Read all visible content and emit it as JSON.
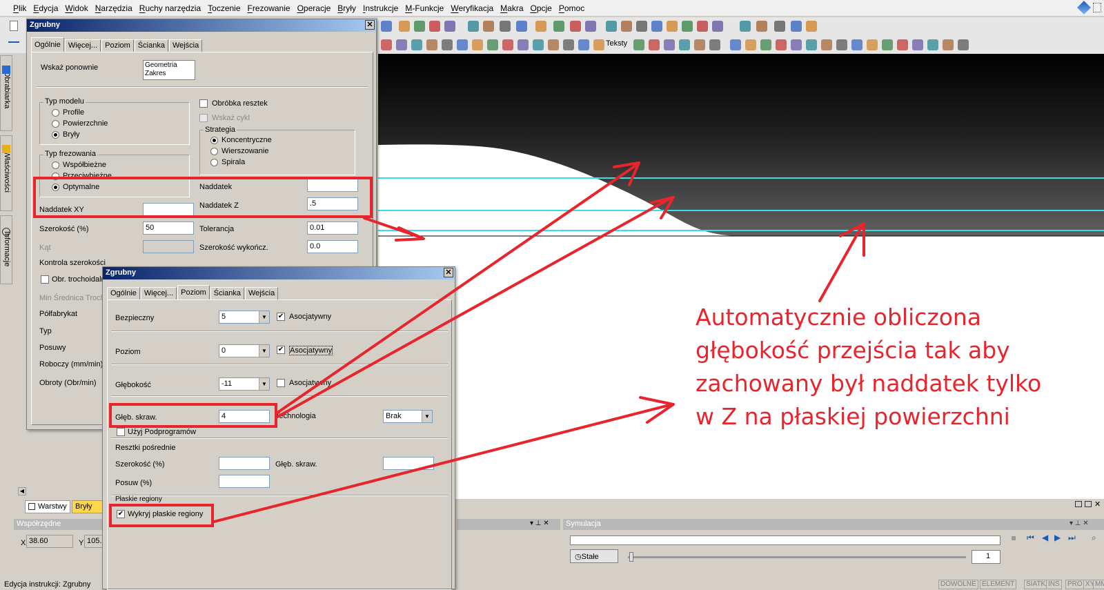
{
  "menu": [
    "Plik",
    "Edycja",
    "Widok",
    "Narzędzia",
    "Ruchy narzędzia",
    "Toczenie",
    "Frezowanie",
    "Operacje",
    "Bryły",
    "Instrukcje",
    "M-Funkcje",
    "Weryfikacja",
    "Makra",
    "Opcje",
    "Pomoc"
  ],
  "toolbar": {
    "teksty_label": "Teksty"
  },
  "side_tabs": [
    "Obrabiarka",
    "Właściwości",
    "Informacje"
  ],
  "dialog1": {
    "title": "Zgrubny",
    "tabs": [
      "Ogólnie",
      "Więcej...",
      "Poziom",
      "Ścianka",
      "Wejścia"
    ],
    "wskaz_label": "Wskaż ponownie",
    "wskaz_list": [
      "Geometria",
      "Zakres"
    ],
    "typ_modelu": {
      "title": "Typ modelu",
      "options": [
        "Profile",
        "Powierzchnie",
        "Bryły"
      ],
      "selected": 2
    },
    "typ_frezowania": {
      "title": "Typ frezowania",
      "options": [
        "Współbieżne",
        "Przeciwbieżne",
        "Optymalne"
      ],
      "selected": 2
    },
    "obrobka_resztek": "Obróbka resztek",
    "wskaz_cykl": "Wskaż cykl",
    "strategia": {
      "title": "Strategia",
      "options": [
        "Koncentryczne",
        "Wierszowanie",
        "Spirala"
      ],
      "selected": 0
    },
    "naddatek_label": "Naddatek",
    "naddatek_value": "",
    "naddatek_xy_label": "Naddatek XY",
    "naddatek_xy_value": "",
    "naddatek_z_label": "Naddatek Z",
    "naddatek_z_value": ".5",
    "szerokosc_label": "Szerokość (%)",
    "szerokosc_value": "50",
    "tolerancja_label": "Tolerancja",
    "tolerancja_value": "0.01",
    "kat_label": "Kąt",
    "szer_wyk_label": "Szerokość wykończ.",
    "szer_wyk_value": "0.0",
    "kontrola_label": "Kontrola szerokości",
    "obr_troch_label": "Obr. trochoidalna",
    "min_srednica_label": "Min Średnica Trochoidalna",
    "polfabrykat_label": "Półfabrykat",
    "typ_label": "Typ",
    "posuwy_label": "Posuwy",
    "roboczy_label": "Roboczy (mm/min)",
    "obroty_label": "Obroty (Obr/min)"
  },
  "dialog2": {
    "title": "Zgrubny",
    "tabs": [
      "Ogólnie",
      "Więcej...",
      "Poziom",
      "Ścianka",
      "Wejścia"
    ],
    "bezpieczny_label": "Bezpieczny",
    "bezpieczny_value": "5",
    "poziom_label": "Poziom",
    "poziom_value": "0",
    "glebokosc_label": "Głębokość",
    "glebokosc_value": "-11",
    "asocjatywny": "Asocjatywny",
    "glebskraw_label": "Głęb. skraw.",
    "glebskraw_value": "4",
    "technologia_label": "Technologia",
    "technologia_value": "Brak",
    "uzyj_label": "Użyj Podprogramów",
    "resztki_label": "Resztki pośrednie",
    "szer_label": "Szerokość (%)",
    "glebskraw2_label": "Głęb. skraw.",
    "posuw_label": "Posuw (%)",
    "plaskie_label": "Płaskie regiony",
    "wykryj_label": "Wykryj płaskie regiony"
  },
  "bottom": {
    "warstwy": "Warstwy",
    "bryly": "Bryły",
    "wspolrzedne": "Współrzędne",
    "x_label": "X",
    "x_value": "38.60",
    "y_label": "Y",
    "y_value": "105.",
    "symulacja": "Symulacja",
    "stale": "Stałe",
    "spin_value": "1",
    "status_left": "Edycja instrukcji:  Zgrubny",
    "status_modes": [
      "DOWOLNE",
      "ELEMENT",
      "SIATKA",
      "INS",
      "PRO",
      "XY",
      "MM"
    ]
  },
  "annotation": [
    "Automatycznie obliczona",
    "głębokość przejścia tak aby",
    "zachowany był naddatek tylko",
    "w Z na płaskiej powierzchni"
  ],
  "colors": {
    "annotation": "#e8242c",
    "toolpath": "#33e0e8",
    "title_bar": "#0a246a"
  }
}
